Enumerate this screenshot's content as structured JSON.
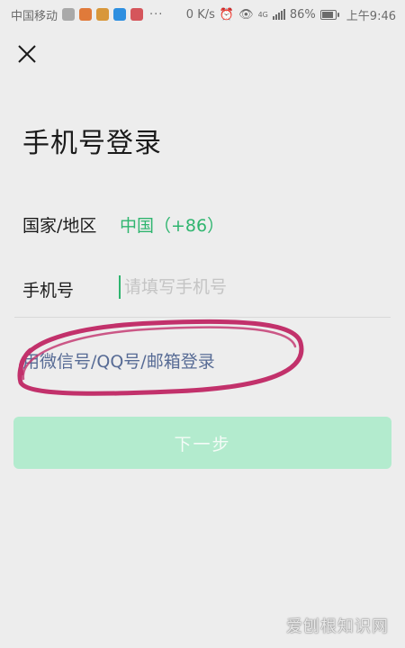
{
  "status_bar": {
    "carrier": "中国移动",
    "dots": "···",
    "net_speed": "0 K/s",
    "network_type": "4G",
    "battery_percent": "86%",
    "battery_level": 0.86,
    "time": "上午9:46",
    "app_icon_colors": [
      "#a9a9a9",
      "#e07a3a",
      "#d8973a",
      "#2d8fe0",
      "#d5555b"
    ]
  },
  "header": {
    "close_icon": "close-icon"
  },
  "title": "手机号登录",
  "region": {
    "label": "国家/地区",
    "value": "中国（+86）"
  },
  "phone": {
    "label": "手机号",
    "value": "",
    "placeholder": "请填写手机号"
  },
  "alt_login": "用微信号/QQ号/邮箱登录",
  "next_button": "下一步",
  "watermark": "爱刨根知识网",
  "colors": {
    "accent_green": "#2fb56f",
    "link_blue": "#576b95",
    "button_disabled": "#b3ebce",
    "annotation": "#c2316b"
  }
}
